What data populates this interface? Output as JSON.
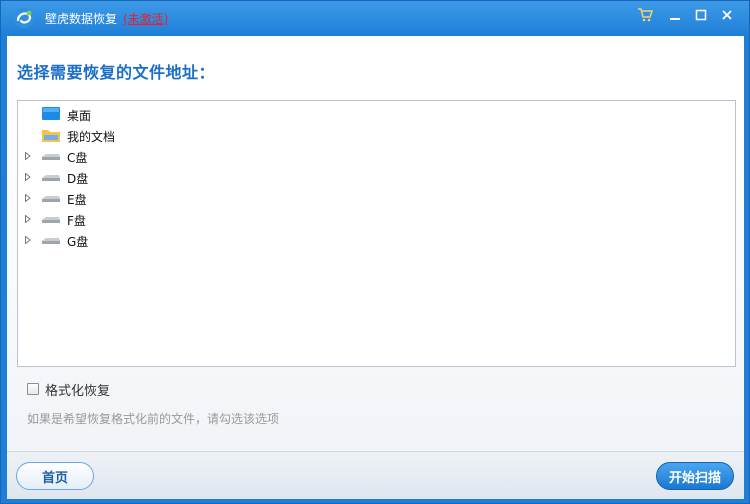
{
  "window": {
    "title": "壁虎数据恢复",
    "status": "(未激活)"
  },
  "heading": "选择需要恢复的文件地址：",
  "tree": {
    "items": [
      {
        "label": "桌面",
        "icon": "desktop-icon",
        "expandable": false
      },
      {
        "label": "我的文档",
        "icon": "folder-icon",
        "expandable": false
      },
      {
        "label": "C盘",
        "icon": "drive-icon",
        "expandable": true
      },
      {
        "label": "D盘",
        "icon": "drive-icon",
        "expandable": true
      },
      {
        "label": "E盘",
        "icon": "drive-icon",
        "expandable": true
      },
      {
        "label": "F盘",
        "icon": "drive-icon",
        "expandable": true
      },
      {
        "label": "G盘",
        "icon": "drive-icon",
        "expandable": true
      }
    ]
  },
  "option": {
    "label": "格式化恢复",
    "checked": false,
    "hint": "如果是希望恢复格式化前的文件，请勾选该选项"
  },
  "footer": {
    "home_label": "首页",
    "scan_label": "开始扫描"
  },
  "colors": {
    "titlebar": "#1f80d8",
    "accent": "#1c6fc8",
    "status_red": "#e8202a"
  }
}
